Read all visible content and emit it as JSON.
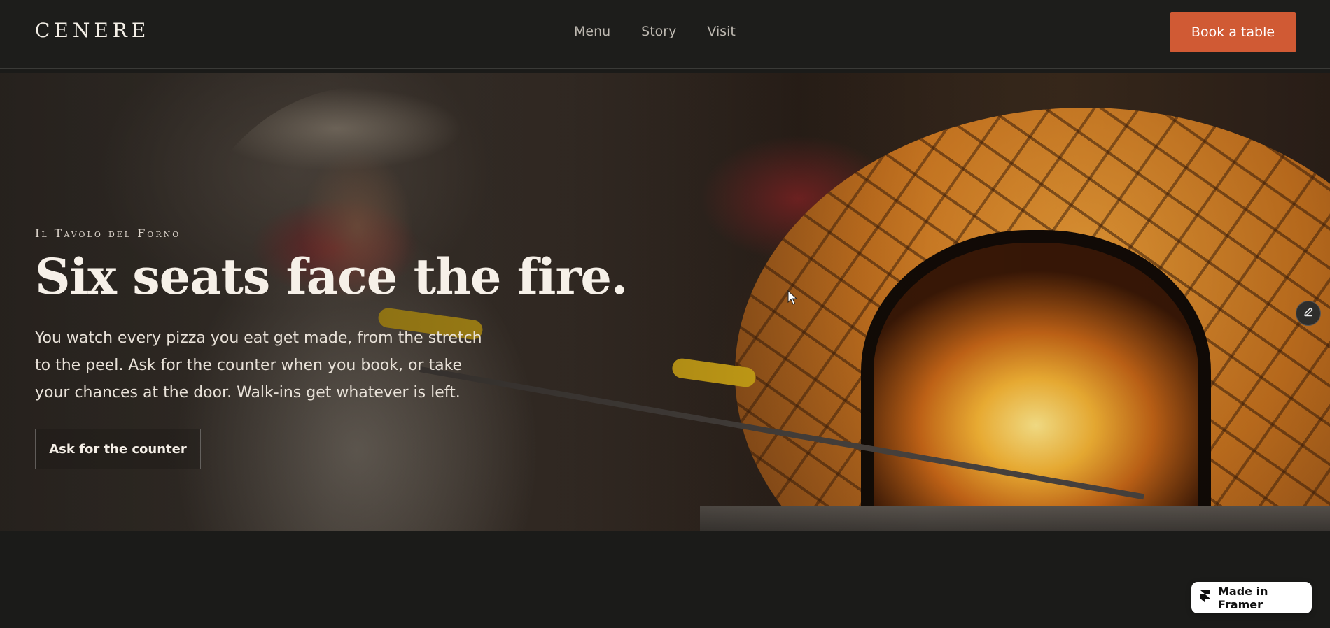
{
  "brand": {
    "logo": "CENERE"
  },
  "nav": {
    "links": [
      {
        "label": "Menu"
      },
      {
        "label": "Story"
      },
      {
        "label": "Visit"
      }
    ],
    "cta_label": "Book a table",
    "cta_color": "#d05a34"
  },
  "hero": {
    "kicker": "Il Tavolo del Forno",
    "headline": "Six seats face the fire.",
    "lede": "You watch every pizza you eat get made, from the stretch to the peel. Ask for the counter when you book, or take your chances at the door. Walk-ins get whatever is left.",
    "button_label": "Ask for the counter",
    "edit_icon": "pencil-icon"
  },
  "badge": {
    "label": "Made in Framer",
    "icon": "framer-logo-icon"
  },
  "colors": {
    "background": "#1b1b19",
    "accent": "#d05a34"
  }
}
